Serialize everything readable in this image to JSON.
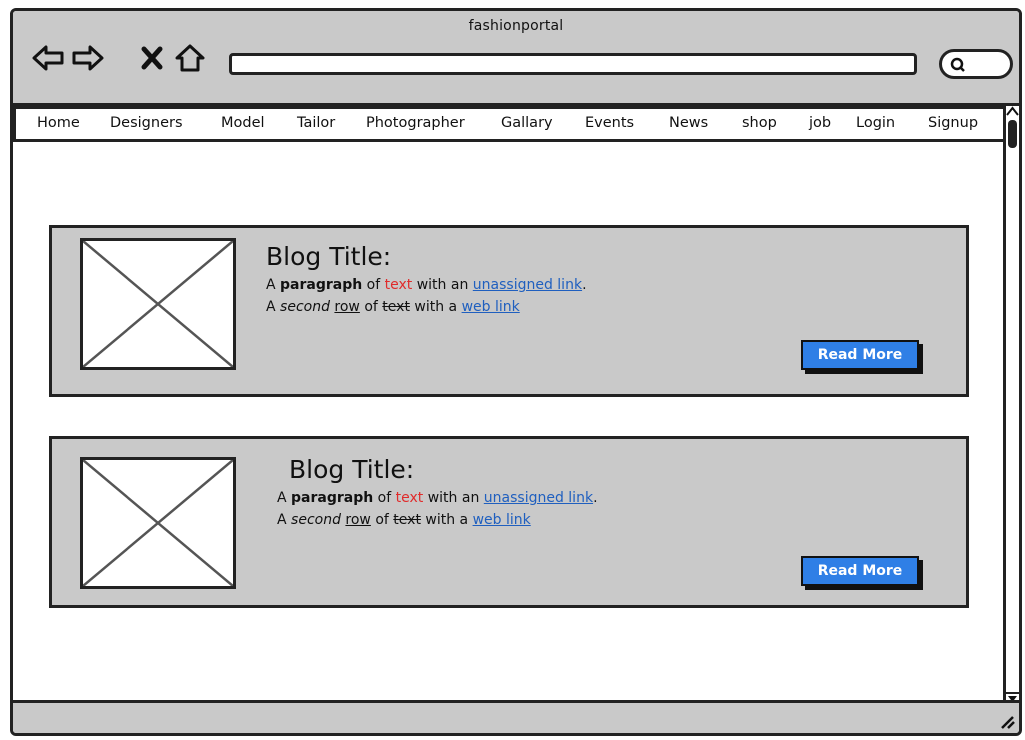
{
  "window": {
    "title": "fashionportal"
  },
  "nav": {
    "back_icon": "arrow-left-icon",
    "forward_icon": "arrow-right-icon",
    "stop_icon": "close-icon",
    "home_icon": "home-icon",
    "search_icon": "search-icon"
  },
  "menu": {
    "items": [
      {
        "label": "Home"
      },
      {
        "label": "Designers"
      },
      {
        "label": "Model"
      },
      {
        "label": "Tailor"
      },
      {
        "label": "Photographer"
      },
      {
        "label": "Gallary"
      },
      {
        "label": "Events"
      },
      {
        "label": "News"
      },
      {
        "label": "shop"
      },
      {
        "label": "job"
      },
      {
        "label": "Login"
      },
      {
        "label": "Signup"
      }
    ]
  },
  "posts": [
    {
      "title": "Blog Title:",
      "p1": {
        "a": "A",
        "bold": "paragraph",
        "of": "of",
        "red": "text",
        "mid": "with an",
        "link": "unassigned link",
        "end": "."
      },
      "p2": {
        "a": "A",
        "italic": "second",
        "under": "row",
        "of": "of",
        "strike": "text",
        "mid": "with a",
        "link": "web link"
      },
      "button": "Read More"
    },
    {
      "title": "Blog  Title:",
      "p1": {
        "a": "A",
        "bold": "paragraph",
        "of": "of",
        "red": "text",
        "mid": "with an",
        "link": "unassigned link",
        "end": "."
      },
      "p2": {
        "a": "A",
        "italic": "second",
        "under": "row",
        "of": "of",
        "strike": "text",
        "mid": "with a",
        "link": "web link"
      },
      "button": "Read More"
    }
  ],
  "colors": {
    "frame": "#c9c9c9",
    "button": "#2f7fe6",
    "link": "#1f5fbf",
    "red_text": "#e02b2b"
  }
}
